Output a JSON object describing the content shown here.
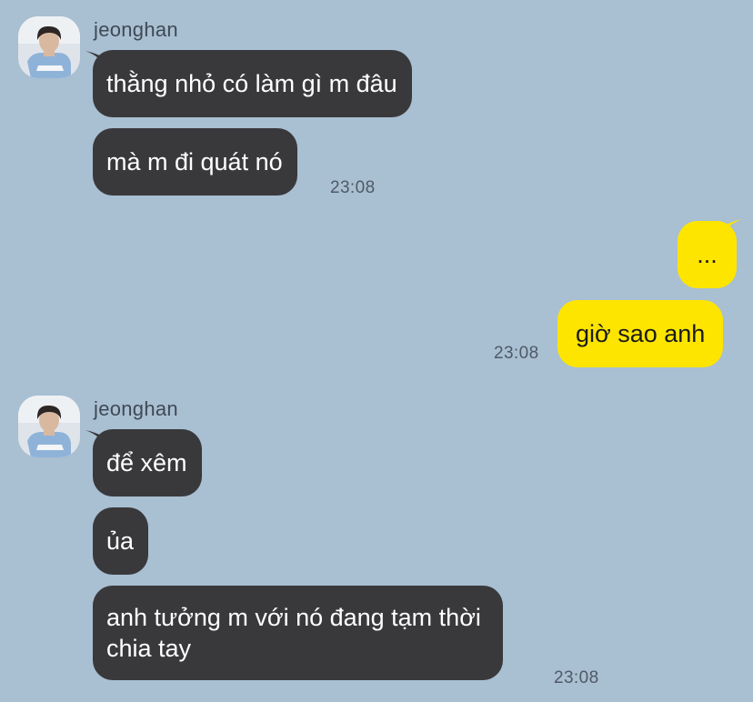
{
  "app": {
    "background": "#a9bfd2",
    "incoming_bubble_color": "#39393c",
    "outgoing_bubble_color": "#fde500"
  },
  "groups": [
    {
      "sender": "jeonghan",
      "avatar_icon": "profile-photo",
      "messages": [
        "thằng nhỏ có làm gì m đâu",
        "mà m đi quát nó"
      ],
      "time": "23:08"
    },
    {
      "sender": "me",
      "messages": [
        "...",
        "giờ sao anh"
      ],
      "time": "23:08"
    },
    {
      "sender": "jeonghan",
      "avatar_icon": "profile-photo",
      "messages": [
        "để xêm",
        "ủa",
        "anh tưởng m với nó đang tạm thời\nchia tay"
      ],
      "time": "23:08"
    }
  ]
}
